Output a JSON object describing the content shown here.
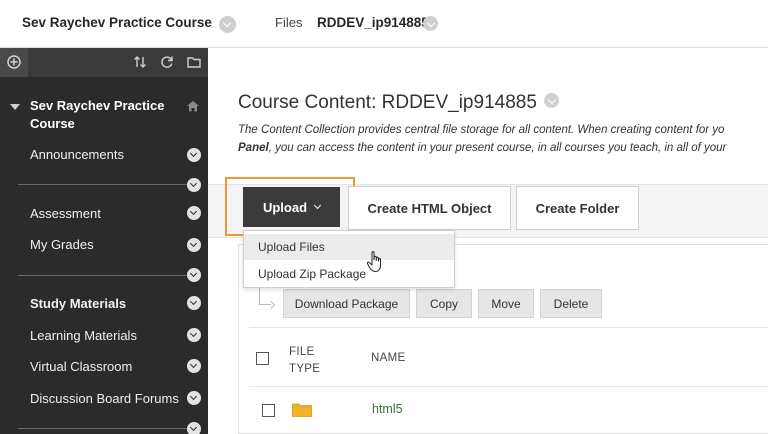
{
  "header": {
    "course_title": "Sev Raychev Practice Course",
    "breadcrumb_files": "Files",
    "breadcrumb_current": "RDDEV_ip914885"
  },
  "sidebar": {
    "course_menu_title": "Sev Raychev Practice Course",
    "items": [
      {
        "label": "Announcements",
        "bold": false
      },
      {
        "label": "Assessment",
        "bold": false
      },
      {
        "label": "My Grades",
        "bold": false
      },
      {
        "label": "Study Materials",
        "bold": true
      },
      {
        "label": "Learning Materials",
        "bold": false
      },
      {
        "label": "Virtual Classroom",
        "bold": false
      },
      {
        "label": "Discussion Board Forums",
        "bold": false
      }
    ]
  },
  "main": {
    "title": "Course Content: RDDEV_ip914885",
    "description_line1": "The Content Collection provides central file storage for all content. When creating content for yo",
    "description_line2_bold": "Panel",
    "description_line2_rest": ", you can access the content in your present course, in all courses you teach, in all of your",
    "actions": {
      "upload_label": "Upload",
      "create_html_label": "Create HTML Object",
      "create_folder_label": "Create Folder"
    },
    "upload_menu": [
      "Upload Files",
      "Upload Zip Package"
    ],
    "toolbar": {
      "download_label": "Download Package",
      "copy_label": "Copy",
      "move_label": "Move",
      "delete_label": "Delete"
    },
    "table": {
      "col_file_type_line1": "FILE",
      "col_file_type_line2": "TYPE",
      "col_name": "NAME",
      "rows": [
        {
          "type_icon": "folder-icon",
          "name": "html5"
        }
      ]
    }
  },
  "colors": {
    "highlight": "#f09637",
    "sidebar_bg": "#2b2b2b",
    "upload_bg": "#3b3b3b",
    "link_green": "#2f7a2f"
  }
}
